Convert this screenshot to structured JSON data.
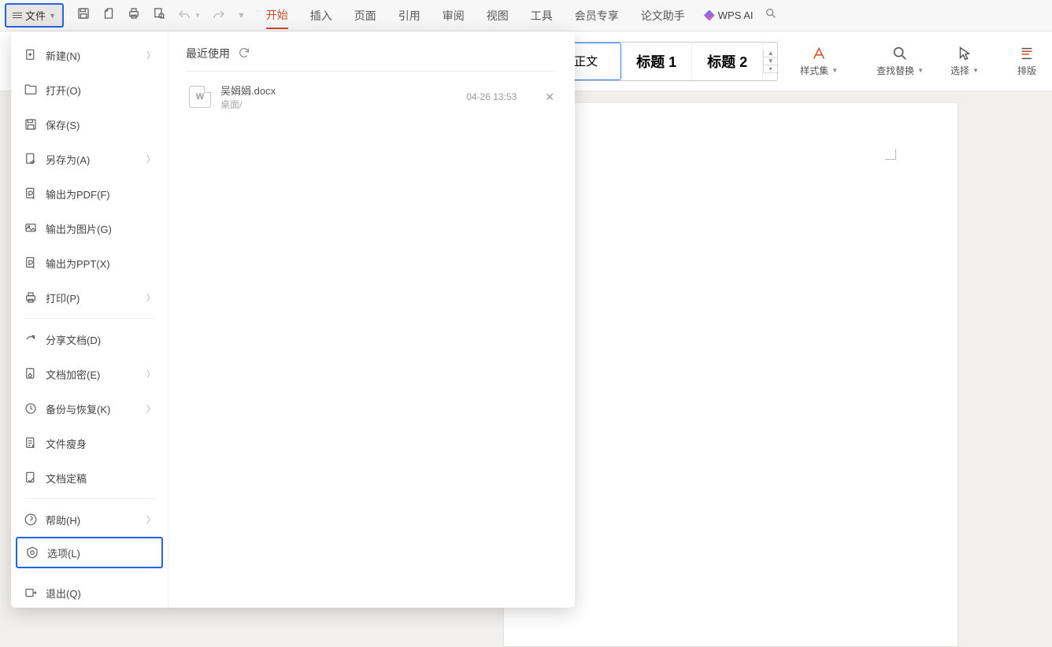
{
  "topbar": {
    "file_label": "文件",
    "tabs": [
      "开始",
      "插入",
      "页面",
      "引用",
      "审阅",
      "视图",
      "工具",
      "会员专享",
      "论文助手"
    ],
    "active_tab": 0,
    "ai_label": "WPS AI"
  },
  "ribbon": {
    "styles": {
      "normal": "正文",
      "h1": "标题 1",
      "h2": "标题 2"
    },
    "styleset": "样式集",
    "find": "查找替换",
    "select": "选择",
    "layout": "排版"
  },
  "file_menu": {
    "items": [
      {
        "label": "新建(N)",
        "arrow": true,
        "sep": false
      },
      {
        "label": "打开(O)",
        "arrow": false,
        "sep": false
      },
      {
        "label": "保存(S)",
        "arrow": false,
        "sep": false
      },
      {
        "label": "另存为(A)",
        "arrow": true,
        "sep": false
      },
      {
        "label": "输出为PDF(F)",
        "arrow": false,
        "sep": false
      },
      {
        "label": "输出为图片(G)",
        "arrow": false,
        "sep": false
      },
      {
        "label": "输出为PPT(X)",
        "arrow": false,
        "sep": false
      },
      {
        "label": "打印(P)",
        "arrow": true,
        "sep": true
      },
      {
        "label": "分享文档(D)",
        "arrow": false,
        "sep": false
      },
      {
        "label": "文档加密(E)",
        "arrow": true,
        "sep": false
      },
      {
        "label": "备份与恢复(K)",
        "arrow": true,
        "sep": false
      },
      {
        "label": "文件瘦身",
        "arrow": false,
        "sep": false
      },
      {
        "label": "文档定稿",
        "arrow": false,
        "sep": true
      },
      {
        "label": "帮助(H)",
        "arrow": true,
        "sep": false
      },
      {
        "label": "选项(L)",
        "arrow": false,
        "sep": true,
        "highlight": true
      },
      {
        "label": "退出(Q)",
        "arrow": false,
        "sep": false
      }
    ]
  },
  "recent": {
    "title": "最近使用",
    "files": [
      {
        "name": "吴娟娟.docx",
        "path": "桌面/",
        "time": "04-26 13:53"
      }
    ]
  }
}
